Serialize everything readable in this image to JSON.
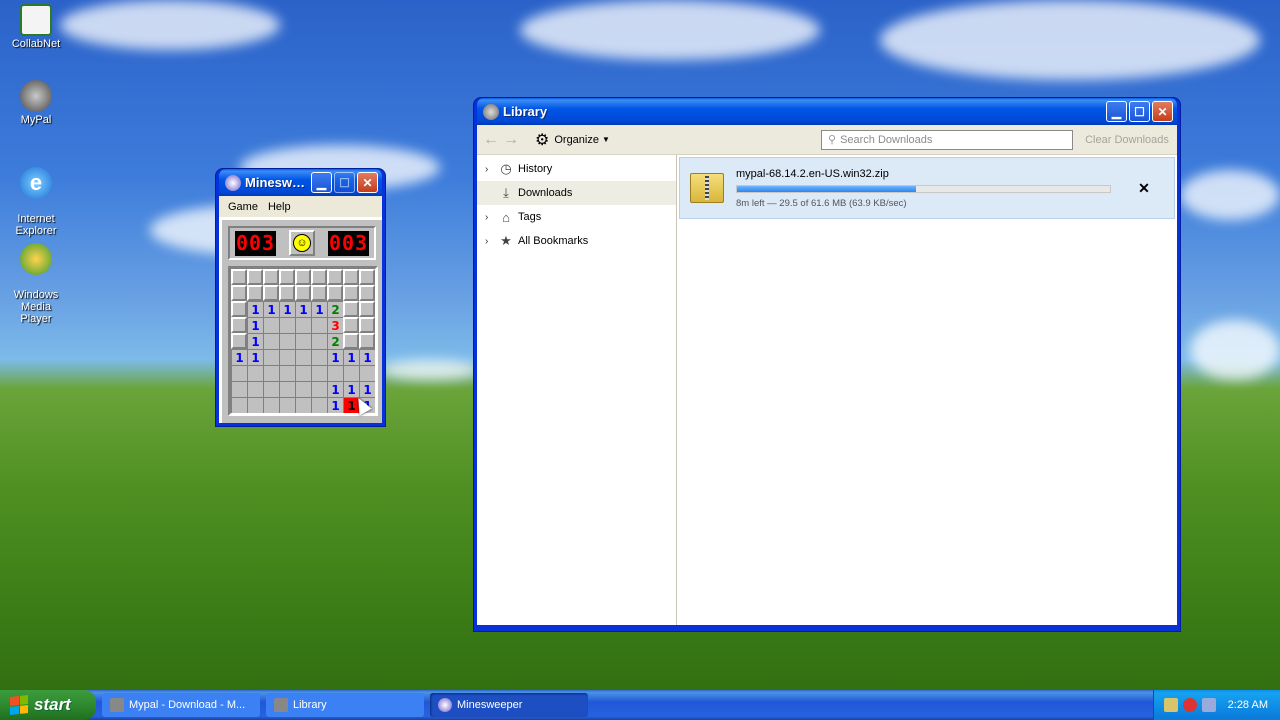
{
  "desktop": {
    "icons": [
      {
        "label": "CollabNet",
        "icon": "collabnet-icon"
      },
      {
        "label": "MyPal",
        "icon": "mypal-icon"
      },
      {
        "label": "Internet\nExplorer",
        "icon": "internet-explorer-icon"
      },
      {
        "label": "Windows Media\nPlayer",
        "icon": "windows-media-player-icon"
      }
    ]
  },
  "minesweeper": {
    "title": "Minesweeper",
    "menu": [
      "Game",
      "Help"
    ],
    "mines_left": "003",
    "timer": "003",
    "smiley": "☺",
    "grid": [
      [
        "h",
        "h",
        "h",
        "h",
        "h",
        "h",
        "h",
        "h",
        "h"
      ],
      [
        "h",
        "h",
        "h",
        "h",
        "h",
        "h",
        "h",
        "h",
        "h"
      ],
      [
        "h",
        "1",
        "1",
        "1",
        "1",
        "1",
        "2",
        "h",
        "h"
      ],
      [
        "h",
        "1",
        "o",
        "o",
        "o",
        "o",
        "3",
        "h",
        "h"
      ],
      [
        "h",
        "1",
        "o",
        "o",
        "o",
        "o",
        "2",
        "h",
        "h"
      ],
      [
        "1",
        "1",
        "o",
        "o",
        "o",
        "o",
        "1",
        "1",
        "1"
      ],
      [
        "o",
        "o",
        "o",
        "o",
        "o",
        "o",
        "o",
        "o",
        "o"
      ],
      [
        "o",
        "o",
        "o",
        "o",
        "o",
        "o",
        "1",
        "1",
        "1"
      ],
      [
        "o",
        "o",
        "o",
        "o",
        "o",
        "o",
        "1",
        "X",
        "1"
      ]
    ],
    "number_colors": {
      "1": "#0000ff",
      "2": "#008000",
      "3": "#ff0000"
    }
  },
  "library": {
    "title": "Library",
    "toolbar": {
      "back": "←",
      "forward": "→",
      "organize_label": "Organize",
      "search_placeholder": "Search Downloads",
      "clear_label": "Clear Downloads"
    },
    "sidebar": [
      {
        "label": "History",
        "icon": "clock-icon",
        "expandable": true
      },
      {
        "label": "Downloads",
        "icon": "download-icon",
        "expandable": false,
        "selected": true
      },
      {
        "label": "Tags",
        "icon": "tag-icon",
        "expandable": true
      },
      {
        "label": "All Bookmarks",
        "icon": "star-icon",
        "expandable": true
      }
    ],
    "download": {
      "filename": "mypal-68.14.2.en-US.win32.zip",
      "status": "8m left — 29.5 of 61.6 MB (63.9 KB/sec)",
      "progress": 0.479
    }
  },
  "taskbar": {
    "start_label": "start",
    "tasks": [
      {
        "label": "Mypal - Download - M...",
        "active": false
      },
      {
        "label": "Library",
        "active": false
      },
      {
        "label": "Minesweeper",
        "active": true
      }
    ],
    "clock": "2:28 AM"
  }
}
